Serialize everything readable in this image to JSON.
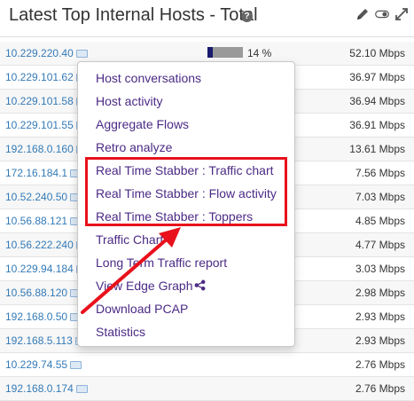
{
  "header": {
    "title": "Latest Top Internal Hosts - Total",
    "help_glyph": "?"
  },
  "rows": [
    {
      "ip": "10.229.220.40",
      "pct": "14 %",
      "pct_value": 0.14,
      "rate": "52.10 Mbps"
    },
    {
      "ip": "10.229.101.62",
      "rate": "36.97 Mbps"
    },
    {
      "ip": "10.229.101.58",
      "rate": "36.94 Mbps"
    },
    {
      "ip": "10.229.101.55",
      "rate": "36.91 Mbps"
    },
    {
      "ip": "192.168.0.160",
      "rate": "13.61 Mbps"
    },
    {
      "ip": "172.16.184.1",
      "rate": "7.56 Mbps"
    },
    {
      "ip": "10.52.240.50",
      "rate": "7.03 Mbps"
    },
    {
      "ip": "10.56.88.121",
      "rate": "4.85 Mbps"
    },
    {
      "ip": "10.56.222.240",
      "rate": "4.77 Mbps"
    },
    {
      "ip": "10.229.94.184",
      "rate": "3.03 Mbps"
    },
    {
      "ip": "10.56.88.120",
      "rate": "2.98 Mbps"
    },
    {
      "ip": "192.168.0.50",
      "rate": "2.93 Mbps"
    },
    {
      "ip": "192.168.5.113",
      "rate": "2.93 Mbps"
    },
    {
      "ip": "10.229.74.55",
      "rate": "2.76 Mbps"
    },
    {
      "ip": "192.168.0.174",
      "rate": "2.76 Mbps"
    }
  ],
  "menu": {
    "items": [
      "Host conversations",
      "Host activity",
      "Aggregate Flows",
      "Retro analyze",
      "Real Time Stabber : Traffic chart",
      "Real Time Stabber : Flow activity",
      "Real Time Stabber : Toppers",
      "Traffic Chart",
      "Long Term Traffic report",
      "View Edge Graph",
      "Download PCAP",
      "Statistics"
    ]
  },
  "colors": {
    "link": "#337ab7",
    "menu_text": "#4b2a85",
    "highlight": "#e8111c",
    "bar_fill": "#1a1a6e",
    "bar_bg": "#9a9a9a"
  },
  "icons": [
    "help-icon",
    "pencil-icon",
    "toggle-icon",
    "expand-icon",
    "network-icon",
    "share-icon"
  ]
}
